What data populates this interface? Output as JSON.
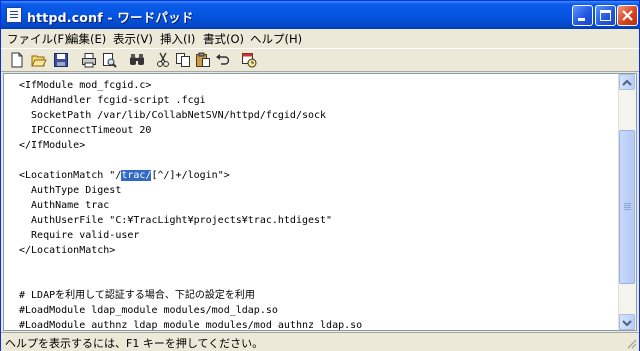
{
  "window": {
    "title": "httpd.conf - ワードパッド"
  },
  "menu": [
    "ファイル(F)",
    "編集(E)",
    "表示(V)",
    "挿入(I)",
    "書式(O)",
    "ヘルプ(H)"
  ],
  "toolbar_icons": [
    "new-icon",
    "open-icon",
    "save-icon",
    "print-icon",
    "print-preview-icon",
    "find-icon",
    "cut-icon",
    "copy-icon",
    "paste-icon",
    "undo-icon",
    "datetime-icon"
  ],
  "document": {
    "lines": [
      "<IfModule mod_fcgid.c>",
      "  AddHandler fcgid-script .fcgi",
      "  SocketPath /var/lib/CollabNetSVN/httpd/fcgid/sock",
      "  IPCConnectTimeout 20",
      "</IfModule>",
      "",
      "<LocationMatch \"/",
      "  AuthType Digest",
      "  AuthName trac",
      "  AuthUserFile \"C:¥TracLight¥projects¥trac.htdigest\"",
      "  Require valid-user",
      "</LocationMatch>",
      "",
      "",
      "# LDAPを利用して認証する場合、下記の設定を利用",
      "#LoadModule ldap_module modules/mod_ldap.so",
      "#LoadModule authnz_ldap_module modules/mod_authnz_ldap.so"
    ],
    "selected_text": "trac/",
    "after_selection": "[^/]+/login\">"
  },
  "status": {
    "text": "ヘルプを表示するには、F1 キーを押してください。"
  },
  "colors": {
    "title_blue": "#0654e2",
    "selection": "#316ac5",
    "chrome": "#ece9d8"
  }
}
